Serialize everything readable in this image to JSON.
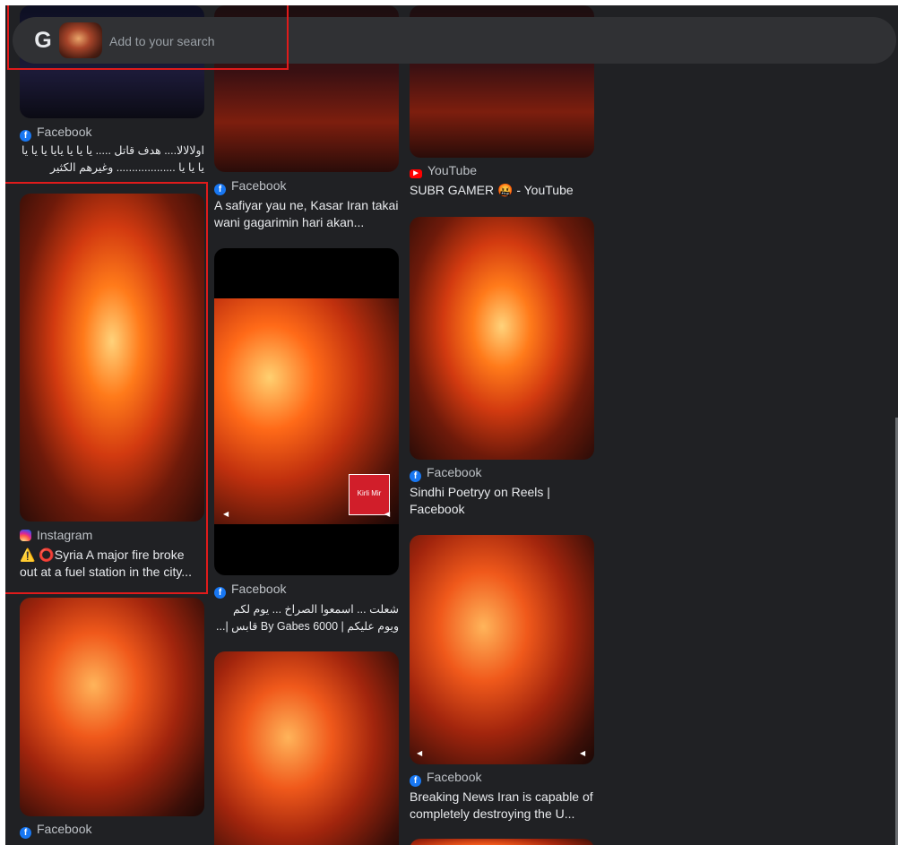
{
  "search": {
    "logo": "G",
    "placeholder": "Add to your search"
  },
  "overlay": {
    "label": "Kirli Mir"
  },
  "results": [
    {
      "source": "Facebook",
      "source_icon": "facebook-icon",
      "title": "اولالالا.... هدف قاتل ..... يا يا يا يايا يا يا يا يا يا يا ................... وغيرهم الكثير شارك في ..."
    },
    {
      "source": "Facebook",
      "source_icon": "facebook-icon",
      "title": "A safiyar yau ne, Kasar Iran takai wani gagarimin hari akan..."
    },
    {
      "source": "YouTube",
      "source_icon": "youtube-icon",
      "title": "SUBR GAMER 🤬 - YouTube"
    },
    {
      "source": "Instagram",
      "source_icon": "instagram-icon",
      "title": "⚠️ ⭕Syria A major fire broke out at a fuel station in the city..."
    },
    {
      "source": "Facebook",
      "source_icon": "facebook-icon",
      "title": "شعلت ... اسمعوا الصراخ ... يوم لكم ويوم عليكم | By Gabes 6000 قابس |..."
    },
    {
      "source": "Facebook",
      "source_icon": "facebook-icon",
      "title": "Sindhi Poetryy on Reels | Facebook"
    },
    {
      "source": "Facebook",
      "source_icon": "facebook-icon",
      "title": "Breaking News Iran is capable of completely destroying the U..."
    },
    {
      "source": "Facebook",
      "source_icon": "facebook-icon",
      "title": ""
    }
  ],
  "colors": {
    "background": "#202124",
    "searchbar": "#303134",
    "highlight": "#e01b1b",
    "facebook": "#1877f2",
    "youtube": "#ff0000"
  }
}
